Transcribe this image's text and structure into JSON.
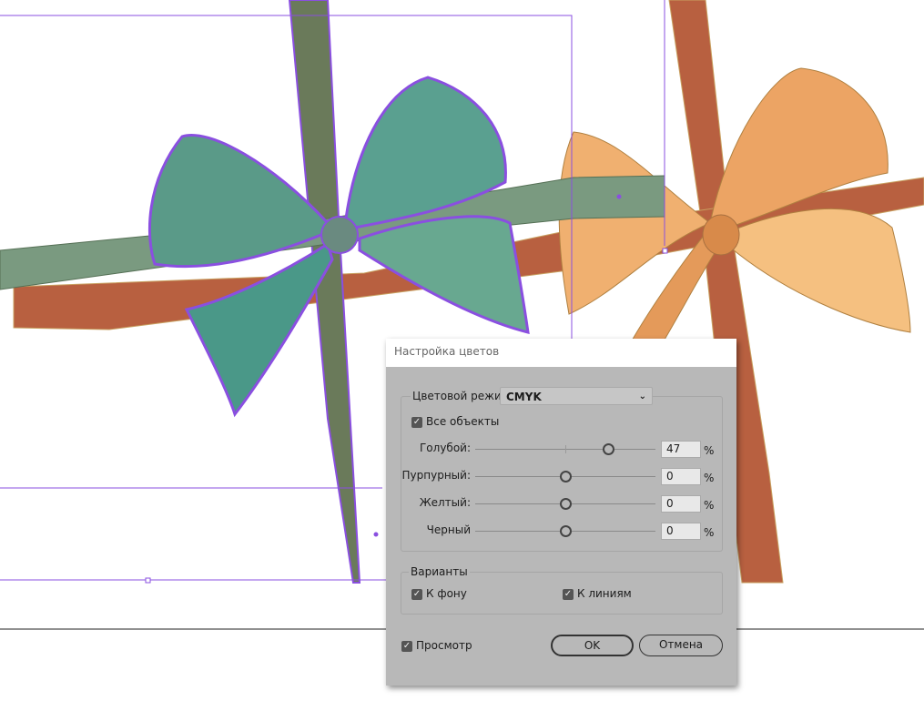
{
  "dialog": {
    "title": "Настройка цветов",
    "color_mode_label": "Цветовой режим:",
    "color_mode_value": "CMYK",
    "all_objects_label": "Все объекты",
    "all_objects_checked": true,
    "sliders": [
      {
        "label": "Голубой:",
        "value": "47",
        "percent": "%",
        "level": 47
      },
      {
        "label": "Пурпурный:",
        "value": "0",
        "percent": "%",
        "level": 0
      },
      {
        "label": "Желтый:",
        "value": "0",
        "percent": "%",
        "level": 0
      },
      {
        "label": "Черный",
        "value": "0",
        "percent": "%",
        "level": 0
      }
    ],
    "slider_range": [
      -100,
      100
    ],
    "variants_label": "Варианты",
    "to_fill_label": "К фону",
    "to_stroke_label": "К линиям",
    "preview_label": "Просмотр",
    "ok_label": "OK",
    "cancel_label": "Отмена"
  },
  "colors": {
    "selection": "#8a4fe0",
    "ribbon_green": "#6a8a6a",
    "ribbon_orange": "#b86040",
    "bow_orange": "#e8a060",
    "dialog_bg": "#b8b8b8"
  }
}
